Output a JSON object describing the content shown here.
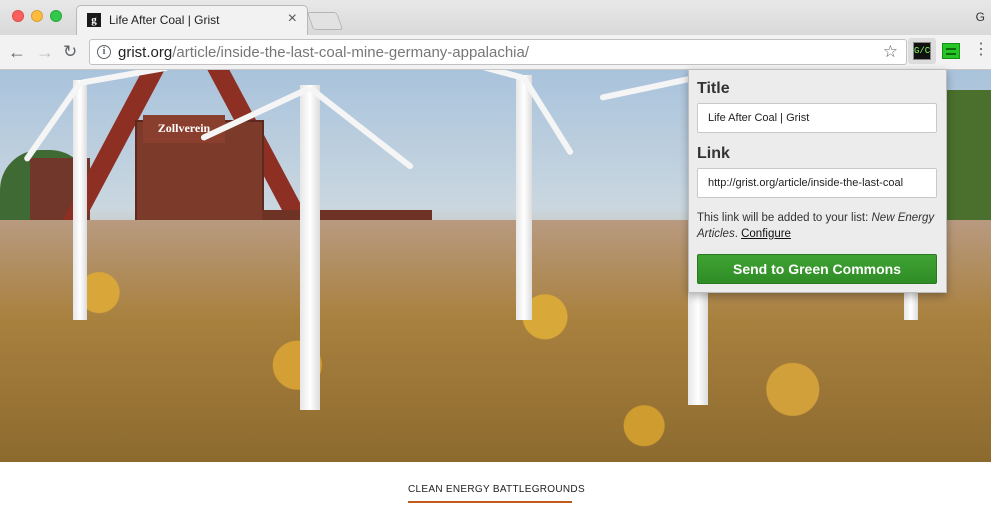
{
  "browser": {
    "tab": {
      "title": "Life After Coal | Grist",
      "favicon_text": "g",
      "close_glyph": "×"
    },
    "profile_initial": "G",
    "address": {
      "host": "grist.org",
      "path": "/article/inside-the-last-coal-mine-germany-appalachia/"
    },
    "icons": {
      "back": "back-arrow-icon",
      "forward": "forward-arrow-icon",
      "reload": "reload-icon",
      "info": "info-icon",
      "bookmark": "star-icon",
      "menu": "more-vertical-icon"
    },
    "extensions": [
      {
        "name": "green-commons-extension",
        "glyph": "G/C"
      },
      {
        "name": "green-extension"
      }
    ]
  },
  "page": {
    "hero_sign": "Zollverein",
    "section_label": "CLEAN ENERGY BATTLEGROUNDS",
    "accent_color": "#c25a1d"
  },
  "popup": {
    "title_label": "Title",
    "title_value": "Life After Coal | Grist",
    "link_label": "Link",
    "link_value": "http://grist.org/article/inside-the-last-coal",
    "note_prefix": "This link will be added to your list: ",
    "note_list": "New Energy Articles",
    "note_sep": ". ",
    "configure_label": "Configure",
    "send_button_label": "Send to Green Commons",
    "button_color": "#2f8c26"
  }
}
